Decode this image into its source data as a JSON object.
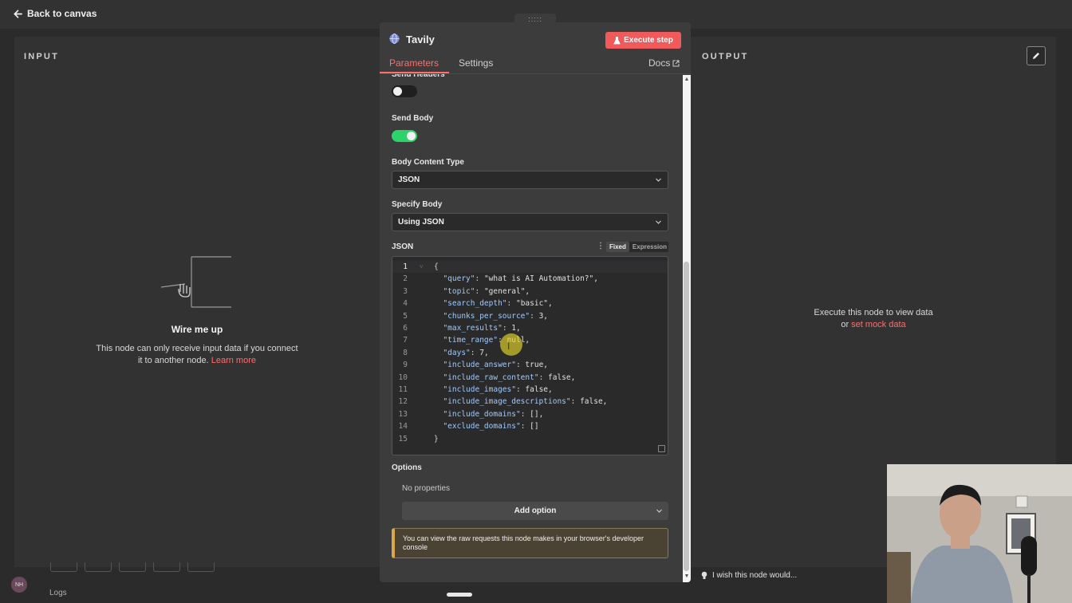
{
  "topbar": {
    "back_label": "Back to canvas"
  },
  "input_panel": {
    "title": "INPUT",
    "wire_title": "Wire me up",
    "wire_text": "This node can only receive input data if you connect it to another node.",
    "learn_more": "Learn more"
  },
  "output_panel": {
    "title": "OUTPUT",
    "execute_text": "Execute this node to view data",
    "or": "or",
    "mock_link": "set mock data"
  },
  "node": {
    "name": "Tavily",
    "execute_label": "Execute step",
    "tabs": [
      {
        "label": "Parameters",
        "active": true
      },
      {
        "label": "Settings",
        "active": false
      }
    ],
    "docs_label": "Docs"
  },
  "params": {
    "send_headers_label": "Send Headers",
    "send_headers_on": false,
    "send_body_label": "Send Body",
    "send_body_on": true,
    "body_content_type_label": "Body Content Type",
    "body_content_type_value": "JSON",
    "specify_body_label": "Specify Body",
    "specify_body_value": "Using JSON",
    "json_label": "JSON",
    "mode_fixed": "Fixed",
    "mode_expression": "Expression",
    "json_lines": [
      {
        "n": "1",
        "text": "{"
      },
      {
        "n": "2",
        "text": "  \"query\": \"what is AI Automation?\","
      },
      {
        "n": "3",
        "text": "  \"topic\": \"general\","
      },
      {
        "n": "4",
        "text": "  \"search_depth\": \"basic\","
      },
      {
        "n": "5",
        "text": "  \"chunks_per_source\": 3,"
      },
      {
        "n": "6",
        "text": "  \"max_results\": 1,"
      },
      {
        "n": "7",
        "text": "  \"time_range\": null,"
      },
      {
        "n": "8",
        "text": "  \"days\": 7,"
      },
      {
        "n": "9",
        "text": "  \"include_answer\": true,"
      },
      {
        "n": "10",
        "text": "  \"include_raw_content\": false,"
      },
      {
        "n": "11",
        "text": "  \"include_images\": false,"
      },
      {
        "n": "12",
        "text": "  \"include_image_descriptions\": false,"
      },
      {
        "n": "13",
        "text": "  \"include_domains\": [],"
      },
      {
        "n": "14",
        "text": "  \"exclude_domains\": []"
      },
      {
        "n": "15",
        "text": "}"
      }
    ],
    "options_label": "Options",
    "no_properties": "No properties",
    "add_option": "Add option",
    "notice": "You can view the raw requests this node makes in your browser's developer console"
  },
  "bottom": {
    "logs_label": "Logs",
    "avatar_initials": "NH",
    "wish_label": "I wish this node would..."
  },
  "colors": {
    "accent": "#ff6d6d",
    "execute_button": "#f05a5a",
    "toggle_on": "#2bd468",
    "json_key": "#9ecbff"
  }
}
